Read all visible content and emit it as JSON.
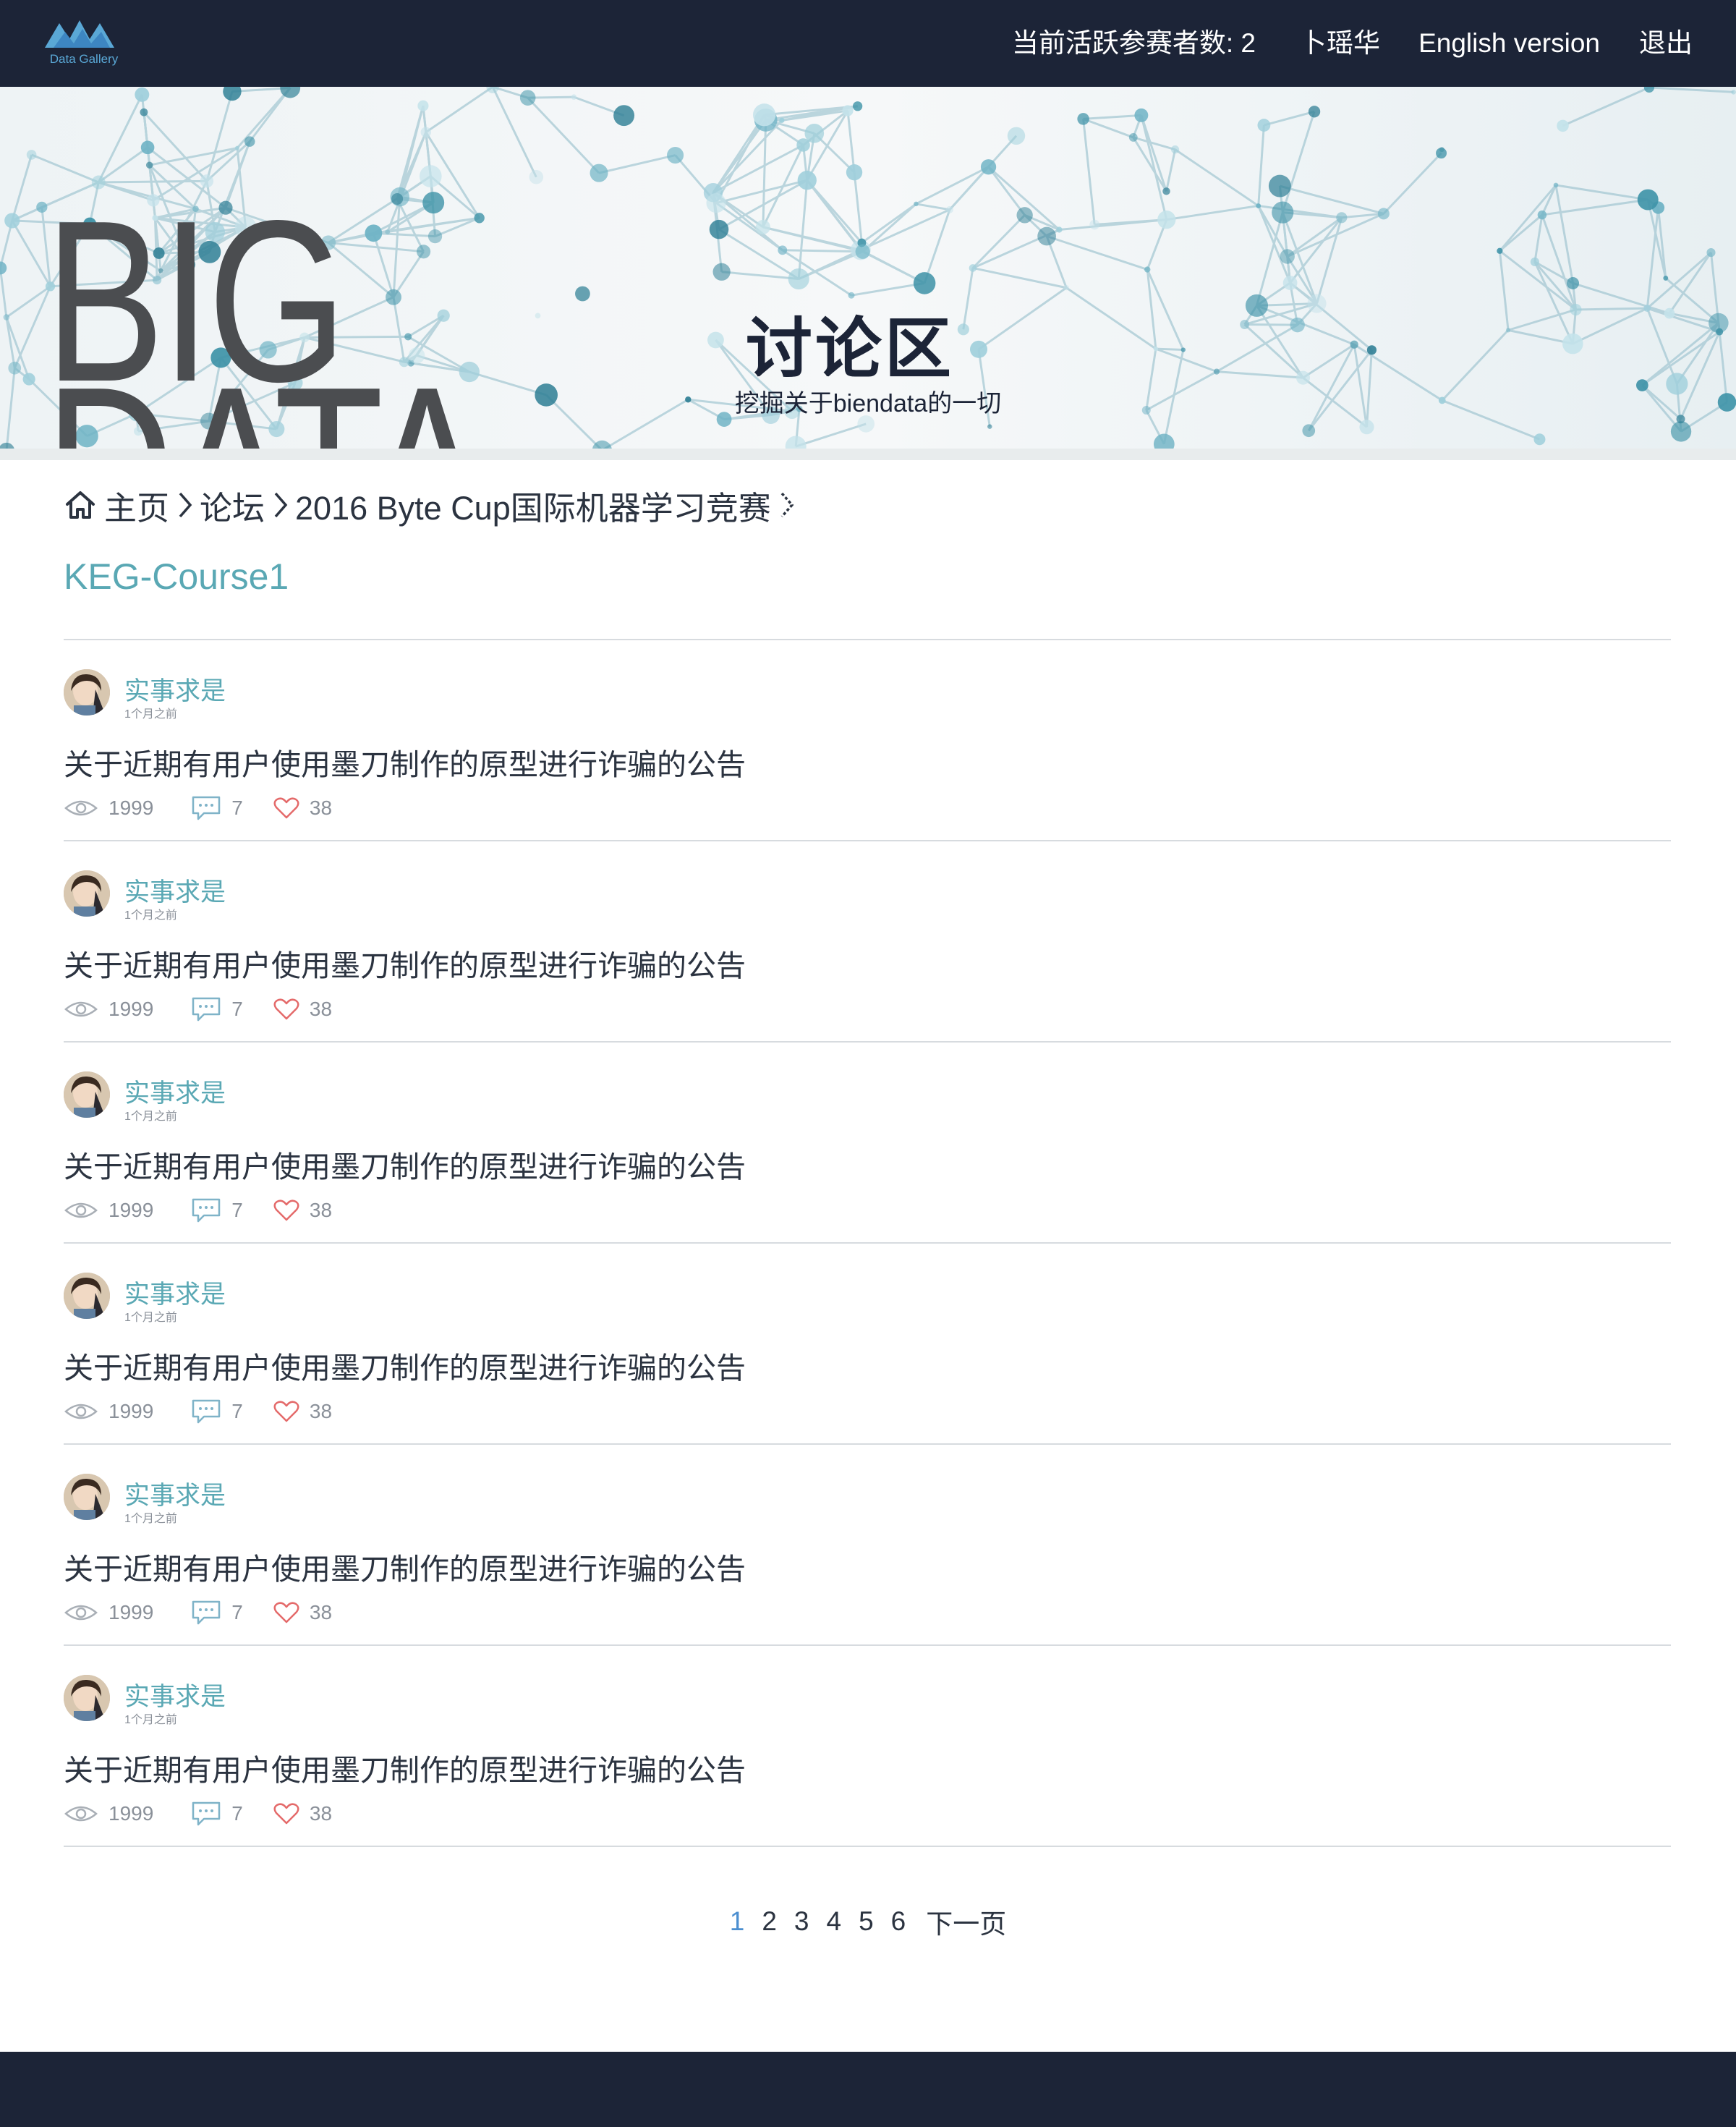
{
  "header": {
    "logo_text": "Data Gallery",
    "active_participants": "当前活跃参赛者数: 2",
    "user_name": "卜瑶华",
    "language_link": "English version",
    "logout": "退出"
  },
  "banner": {
    "big_word_1": "BIG",
    "big_word_2": "DATA",
    "title": "讨论区",
    "subtitle": "挖掘关于biendata的一切"
  },
  "breadcrumb": {
    "home": "主页",
    "forum": "论坛",
    "competition": "2016 Byte Cup国际机器学习竞赛"
  },
  "page_title": "KEG-Course1",
  "posts": [
    {
      "author": "实事求是",
      "time_ago": "1个月之前",
      "title": "关于近期有用户使用墨刀制作的原型进行诈骗的公告",
      "views": "1999",
      "comments": "7",
      "likes": "38"
    },
    {
      "author": "实事求是",
      "time_ago": "1个月之前",
      "title": "关于近期有用户使用墨刀制作的原型进行诈骗的公告",
      "views": "1999",
      "comments": "7",
      "likes": "38"
    },
    {
      "author": "实事求是",
      "time_ago": "1个月之前",
      "title": "关于近期有用户使用墨刀制作的原型进行诈骗的公告",
      "views": "1999",
      "comments": "7",
      "likes": "38"
    },
    {
      "author": "实事求是",
      "time_ago": "1个月之前",
      "title": "关于近期有用户使用墨刀制作的原型进行诈骗的公告",
      "views": "1999",
      "comments": "7",
      "likes": "38"
    },
    {
      "author": "实事求是",
      "time_ago": "1个月之前",
      "title": "关于近期有用户使用墨刀制作的原型进行诈骗的公告",
      "views": "1999",
      "comments": "7",
      "likes": "38"
    },
    {
      "author": "实事求是",
      "time_ago": "1个月之前",
      "title": "关于近期有用户使用墨刀制作的原型进行诈骗的公告",
      "views": "1999",
      "comments": "7",
      "likes": "38"
    }
  ],
  "pagination": {
    "pages": [
      "1",
      "2",
      "3",
      "4",
      "5",
      "6"
    ],
    "current": "1",
    "next_label": "下一页"
  },
  "colors": {
    "nav_background": "#1c2437",
    "accent_teal": "#5aa8b4",
    "active_page": "#4c8fd0",
    "like_heart": "#e46a6a"
  },
  "icons": {
    "logo": "mountain-logo-icon",
    "home": "home-icon",
    "separator": "chevron-right-icon",
    "views": "eye-icon",
    "comments": "comment-bubble-icon",
    "likes": "heart-icon"
  }
}
